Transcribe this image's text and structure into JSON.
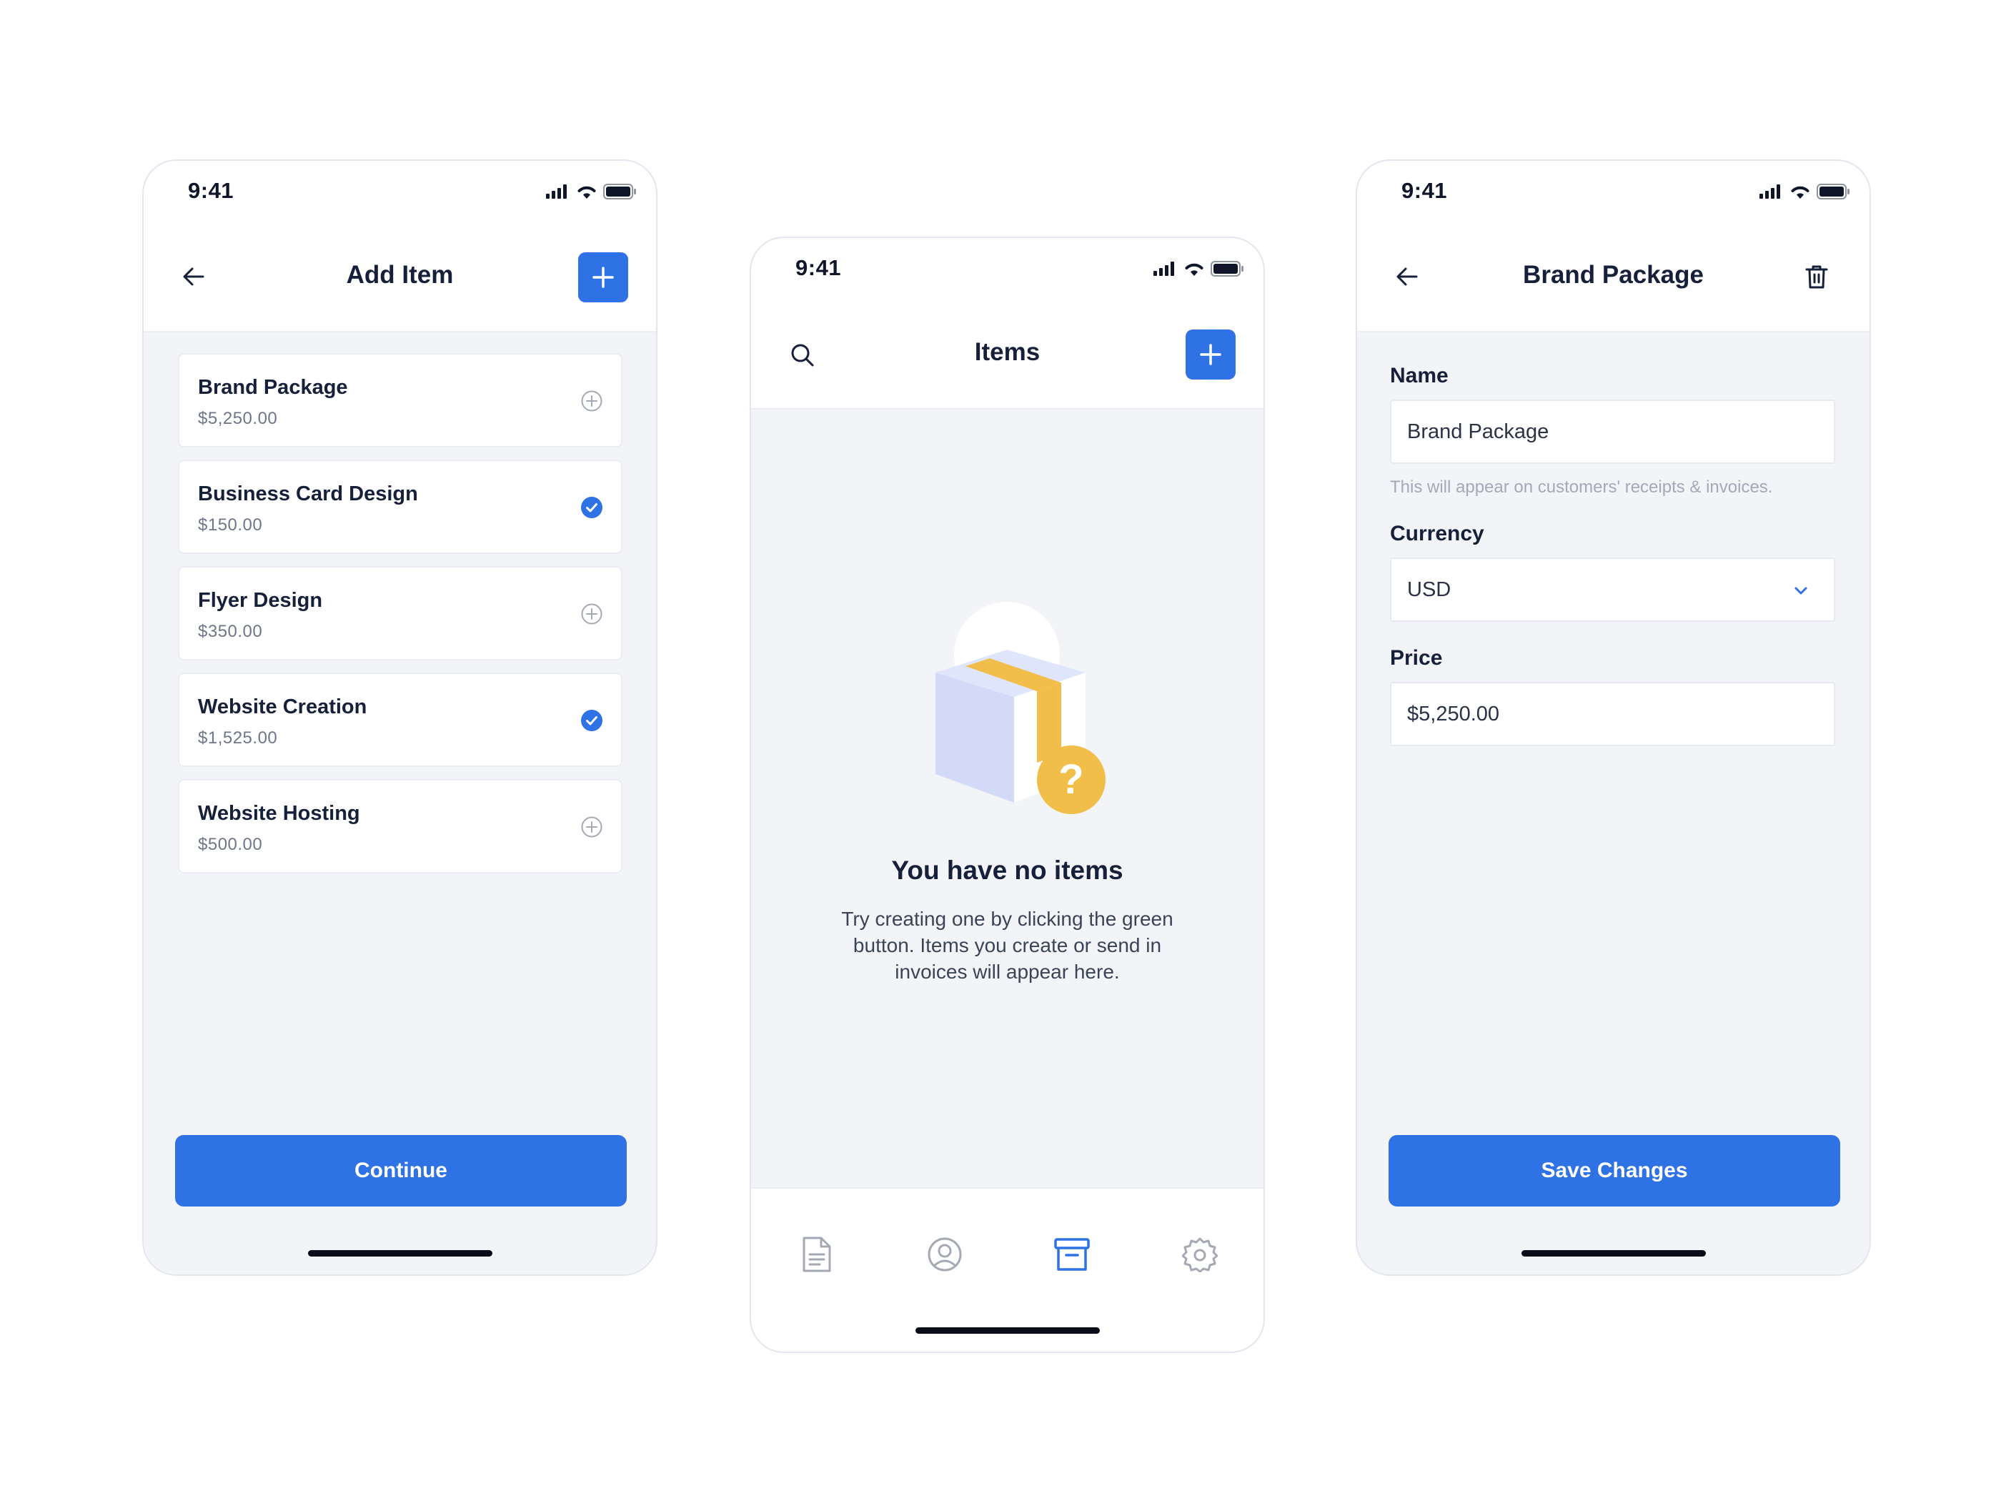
{
  "colors": {
    "primary": "#2e72e6",
    "page_background": "#f3f4f8",
    "accent_yellow": "#f2be4a",
    "box_lavender": "#d5dcfb"
  },
  "status_bar": {
    "time": "9:41"
  },
  "add_item_screen": {
    "title": "Add Item",
    "items": [
      {
        "name": "Brand Package",
        "price": "$5,250.00",
        "selected": false
      },
      {
        "name": "Business Card Design",
        "price": "$150.00",
        "selected": true
      },
      {
        "name": "Flyer Design",
        "price": "$350.00",
        "selected": false
      },
      {
        "name": "Website Creation",
        "price": "$1,525.00",
        "selected": true
      },
      {
        "name": "Website Hosting",
        "price": "$500.00",
        "selected": false
      }
    ],
    "continue_label": "Continue"
  },
  "items_screen": {
    "title": "Items",
    "empty_title": "You have no items",
    "empty_message": "Try creating one by clicking the green button. Items you create or send in invoices will appear here.",
    "tabs": [
      {
        "icon": "document-icon",
        "active": false
      },
      {
        "icon": "user-circle-icon",
        "active": false
      },
      {
        "icon": "archive-box-icon",
        "active": true
      },
      {
        "icon": "gear-icon",
        "active": false
      }
    ]
  },
  "edit_item_screen": {
    "title": "Brand Package",
    "name_label": "Name",
    "name_value": "Brand Package",
    "name_help": "This will appear on customers' receipts & invoices.",
    "currency_label": "Currency",
    "currency_value": "USD",
    "price_label": "Price",
    "price_value": "$5,250.00",
    "save_label": "Save Changes"
  }
}
